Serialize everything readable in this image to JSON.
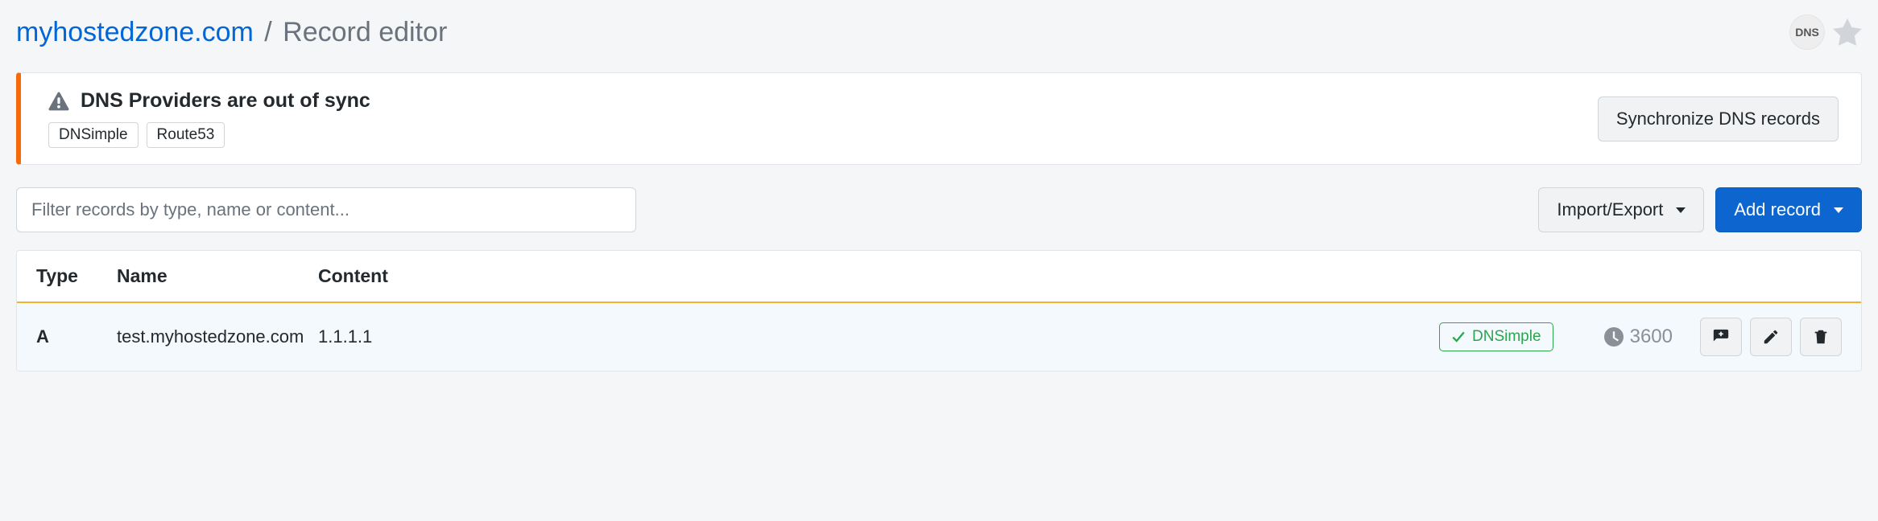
{
  "breadcrumb": {
    "domain": "myhostedzone.com",
    "separator": "/",
    "current": "Record editor"
  },
  "header": {
    "dns_badge": "DNS"
  },
  "alert": {
    "title": "DNS Providers are out of sync",
    "providers": [
      "DNSimple",
      "Route53"
    ],
    "sync_button": "Synchronize DNS records"
  },
  "filter": {
    "placeholder": "Filter records by type, name or content..."
  },
  "toolbar": {
    "import_export": "Import/Export",
    "add_record": "Add record"
  },
  "table": {
    "columns": {
      "type": "Type",
      "name": "Name",
      "content": "Content"
    },
    "rows": [
      {
        "type": "A",
        "name": "test.myhostedzone.com",
        "content": "1.1.1.1",
        "synced_provider": "DNSimple",
        "ttl": "3600"
      }
    ]
  }
}
